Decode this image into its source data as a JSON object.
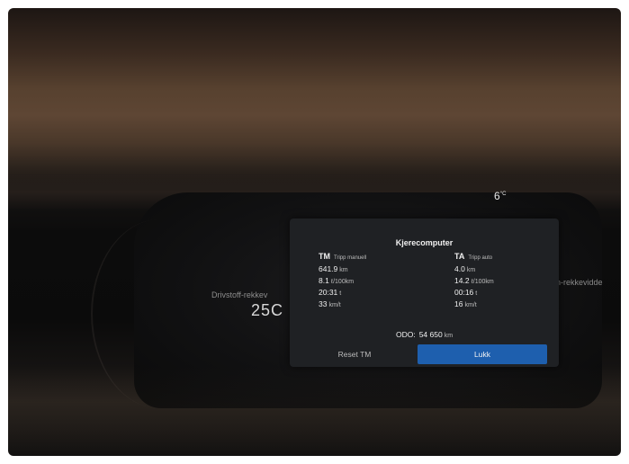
{
  "temperature": {
    "value": "6",
    "unit": "°C"
  },
  "side_left": {
    "label": "Drivstoff-rekkev",
    "value": "25C"
  },
  "side_right": {
    "label": "en-rekkevidde"
  },
  "trip_computer": {
    "title": "Kjerecomputer",
    "manual": {
      "abbr": "TM",
      "name": "Tripp manuell",
      "rows": [
        {
          "value": "641.9",
          "unit": "km"
        },
        {
          "value": "8.1",
          "unit": "ℓ/100km"
        },
        {
          "value": "20:31",
          "unit": "t"
        },
        {
          "value": "33",
          "unit": "km/t"
        }
      ]
    },
    "auto": {
      "abbr": "TA",
      "name": "Tripp auto",
      "rows": [
        {
          "value": "4.0",
          "unit": "km"
        },
        {
          "value": "14.2",
          "unit": "ℓ/100km"
        },
        {
          "value": "00:16",
          "unit": "t"
        },
        {
          "value": "16",
          "unit": "km/t"
        }
      ]
    },
    "odo": {
      "label": "ODO:",
      "value": "54 650",
      "unit": "km"
    },
    "buttons": {
      "reset": "Reset TM",
      "close": "Lukk"
    },
    "accent_color": "#1e5fae"
  }
}
